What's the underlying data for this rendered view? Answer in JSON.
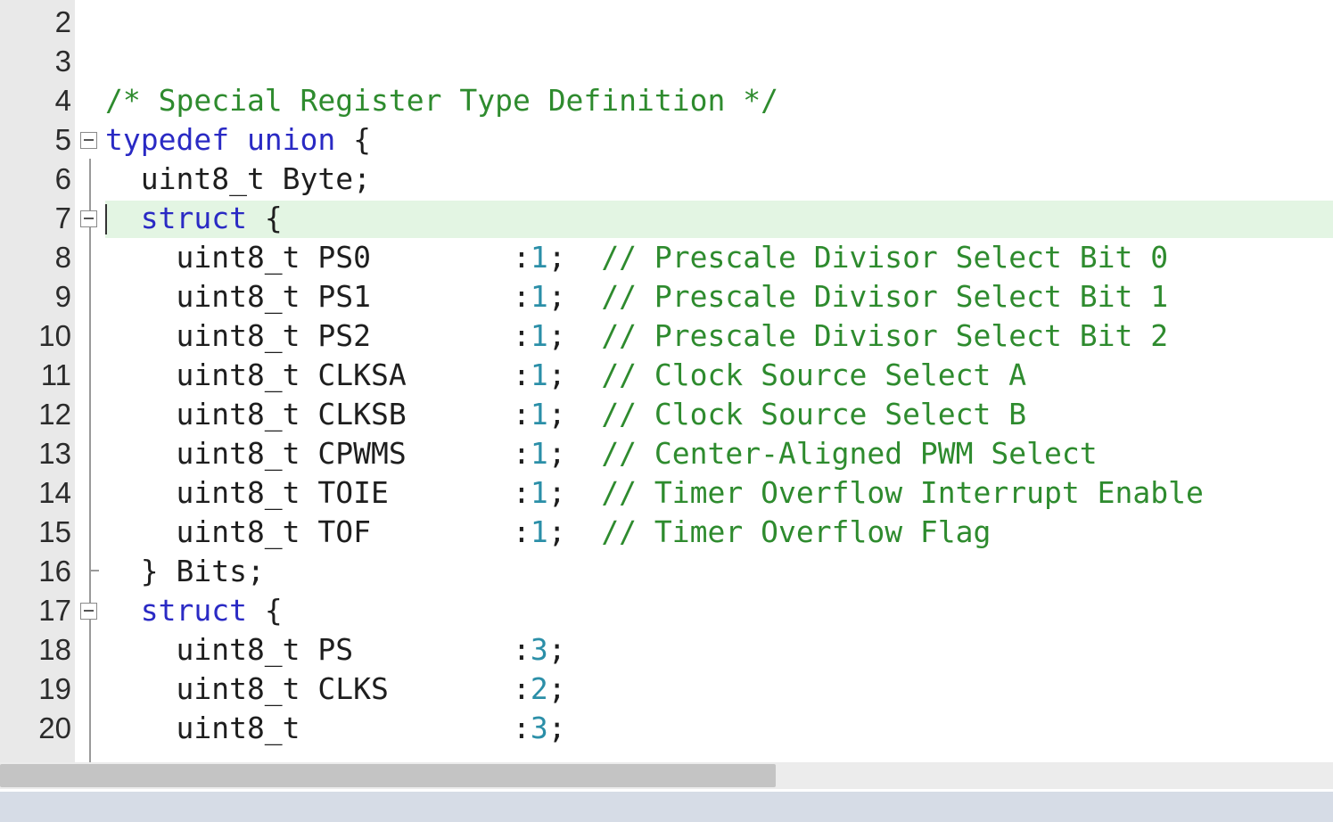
{
  "lines": [
    {
      "n": "2",
      "segments": []
    },
    {
      "n": "3",
      "segments": []
    },
    {
      "n": "4",
      "segments": [
        {
          "t": "/* Special Register Type Definition */",
          "c": "cm"
        }
      ]
    },
    {
      "n": "5",
      "fold": "open",
      "segments": [
        {
          "t": "typedef union",
          "c": "kw"
        },
        {
          "t": " {",
          "c": ""
        }
      ]
    },
    {
      "n": "6",
      "segments": [
        {
          "t": "  uint8_t Byte;",
          "c": ""
        }
      ]
    },
    {
      "n": "7",
      "fold": "open",
      "current": true,
      "segments": [
        {
          "t": "  ",
          "c": ""
        },
        {
          "t": "struct",
          "c": "kw"
        },
        {
          "t": " {",
          "c": ""
        }
      ]
    },
    {
      "n": "8",
      "segments": [
        {
          "t": "    uint8_t PS0        :",
          "c": ""
        },
        {
          "t": "1",
          "c": "num"
        },
        {
          "t": ";  ",
          "c": ""
        },
        {
          "t": "// Prescale Divisor Select Bit 0",
          "c": "cm"
        }
      ]
    },
    {
      "n": "9",
      "segments": [
        {
          "t": "    uint8_t PS1        :",
          "c": ""
        },
        {
          "t": "1",
          "c": "num"
        },
        {
          "t": ";  ",
          "c": ""
        },
        {
          "t": "// Prescale Divisor Select Bit 1",
          "c": "cm"
        }
      ]
    },
    {
      "n": "10",
      "segments": [
        {
          "t": "    uint8_t PS2        :",
          "c": ""
        },
        {
          "t": "1",
          "c": "num"
        },
        {
          "t": ";  ",
          "c": ""
        },
        {
          "t": "// Prescale Divisor Select Bit 2",
          "c": "cm"
        }
      ]
    },
    {
      "n": "11",
      "segments": [
        {
          "t": "    uint8_t CLKSA      :",
          "c": ""
        },
        {
          "t": "1",
          "c": "num"
        },
        {
          "t": ";  ",
          "c": ""
        },
        {
          "t": "// Clock Source Select A",
          "c": "cm"
        }
      ]
    },
    {
      "n": "12",
      "segments": [
        {
          "t": "    uint8_t CLKSB      :",
          "c": ""
        },
        {
          "t": "1",
          "c": "num"
        },
        {
          "t": ";  ",
          "c": ""
        },
        {
          "t": "// Clock Source Select B",
          "c": "cm"
        }
      ]
    },
    {
      "n": "13",
      "segments": [
        {
          "t": "    uint8_t CPWMS      :",
          "c": ""
        },
        {
          "t": "1",
          "c": "num"
        },
        {
          "t": ";  ",
          "c": ""
        },
        {
          "t": "// Center-Aligned PWM Select",
          "c": "cm"
        }
      ]
    },
    {
      "n": "14",
      "segments": [
        {
          "t": "    uint8_t TOIE       :",
          "c": ""
        },
        {
          "t": "1",
          "c": "num"
        },
        {
          "t": ";  ",
          "c": ""
        },
        {
          "t": "// Timer Overflow Interrupt Enable",
          "c": "cm"
        }
      ]
    },
    {
      "n": "15",
      "segments": [
        {
          "t": "    uint8_t TOF        :",
          "c": ""
        },
        {
          "t": "1",
          "c": "num"
        },
        {
          "t": ";  ",
          "c": ""
        },
        {
          "t": "// Timer Overflow Flag",
          "c": "cm"
        }
      ]
    },
    {
      "n": "16",
      "fold": "end",
      "segments": [
        {
          "t": "  } Bits;",
          "c": ""
        }
      ]
    },
    {
      "n": "17",
      "fold": "open",
      "segments": [
        {
          "t": "  ",
          "c": ""
        },
        {
          "t": "struct",
          "c": "kw"
        },
        {
          "t": " {",
          "c": ""
        }
      ]
    },
    {
      "n": "18",
      "segments": [
        {
          "t": "    uint8_t PS         :",
          "c": ""
        },
        {
          "t": "3",
          "c": "num"
        },
        {
          "t": ";",
          "c": ""
        }
      ]
    },
    {
      "n": "19",
      "segments": [
        {
          "t": "    uint8_t CLKS       :",
          "c": ""
        },
        {
          "t": "2",
          "c": "num"
        },
        {
          "t": ";",
          "c": ""
        }
      ]
    },
    {
      "n": "20",
      "segments": [
        {
          "t": "    uint8_t            :",
          "c": ""
        },
        {
          "t": "3",
          "c": "num"
        },
        {
          "t": ";",
          "c": ""
        }
      ]
    }
  ],
  "colors": {
    "keyword": "#2a2ac4",
    "comment": "#2e8b2e",
    "number": "#2b8fa8",
    "current_line": "#e3f5e3",
    "gutter": "#e9e9e9"
  }
}
